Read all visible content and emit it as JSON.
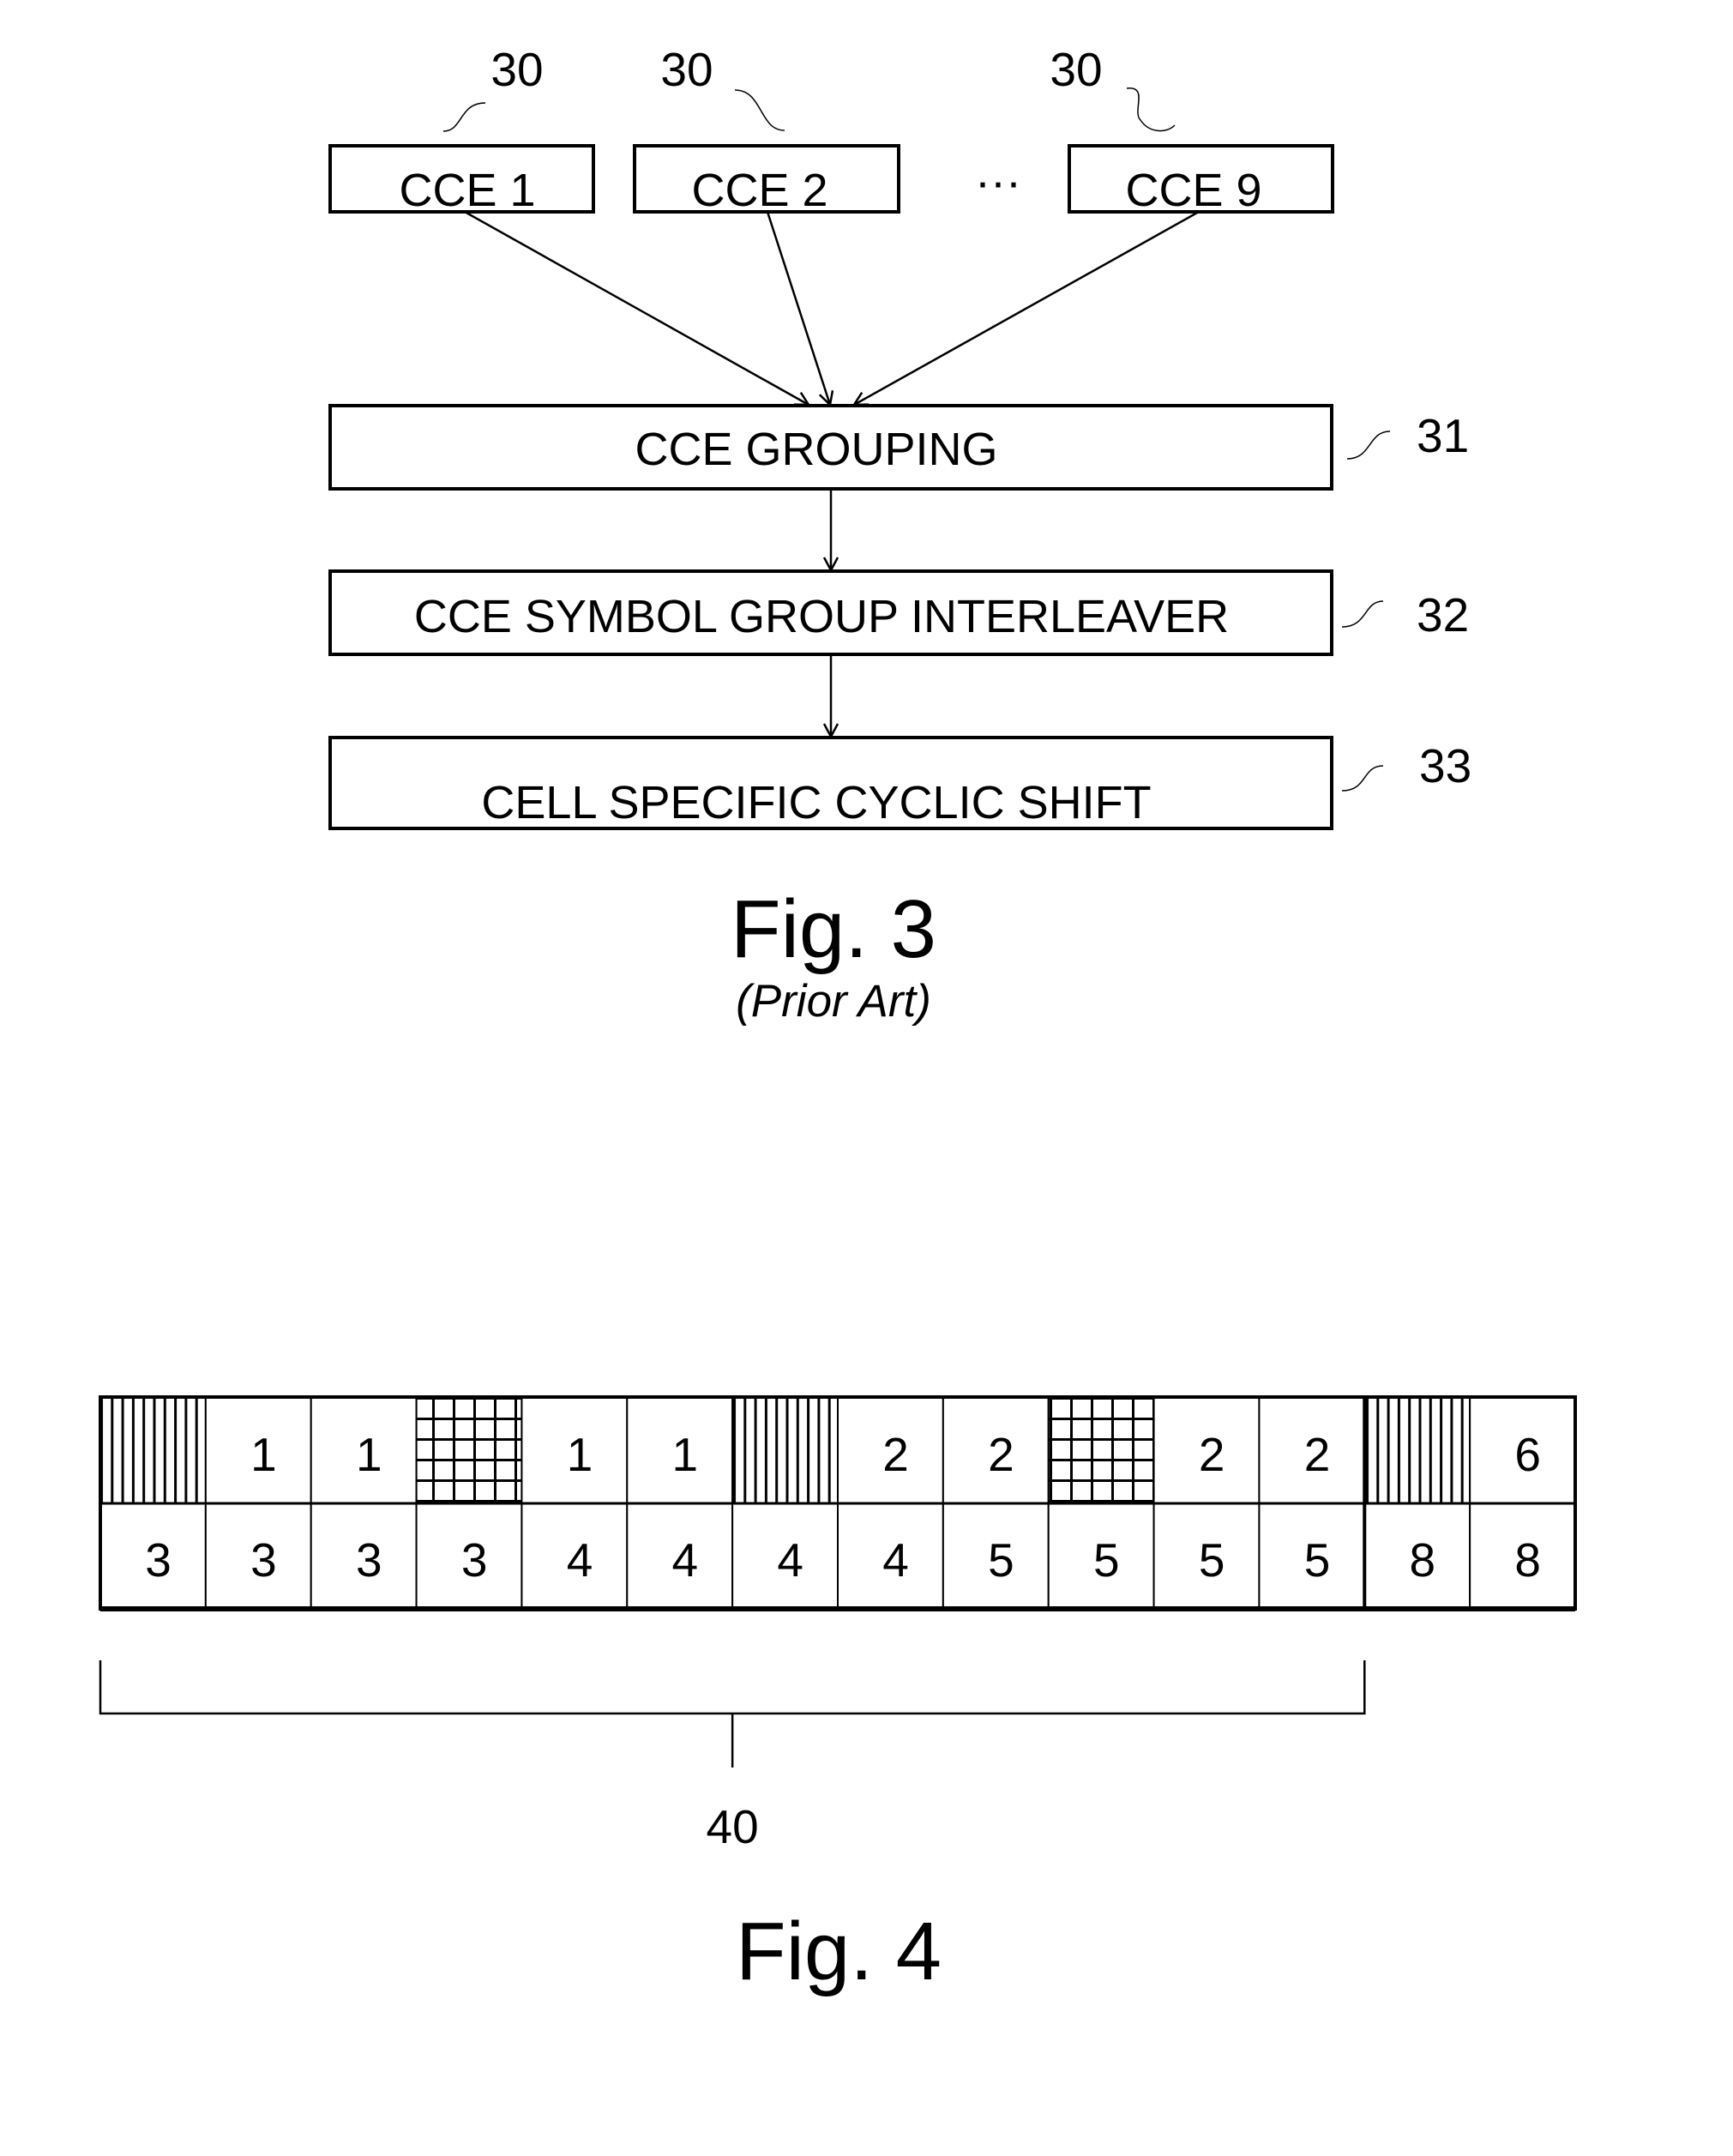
{
  "fig3": {
    "cce_blocks": [
      {
        "label": "CCE 1",
        "ref": "30"
      },
      {
        "label": "CCE 2",
        "ref": "30"
      },
      {
        "label": "CCE 9",
        "ref": "30"
      }
    ],
    "ellipsis": "···",
    "stages": [
      {
        "label": "CCE GROUPING",
        "ref": "31"
      },
      {
        "label": "CCE SYMBOL GROUP INTERLEAVER",
        "ref": "32"
      },
      {
        "label": "CELL SPECIFIC CYCLIC SHIFT",
        "ref": "33"
      }
    ],
    "caption": "Fig. 3",
    "subcaption": "(Prior Art)"
  },
  "fig4": {
    "top_row": [
      {
        "value": "",
        "pattern": "vertical-stripes"
      },
      {
        "value": "1",
        "pattern": "none"
      },
      {
        "value": "1",
        "pattern": "none"
      },
      {
        "value": "",
        "pattern": "crosshatch"
      },
      {
        "value": "1",
        "pattern": "none"
      },
      {
        "value": "1",
        "pattern": "none"
      },
      {
        "value": "",
        "pattern": "vertical-stripes"
      },
      {
        "value": "2",
        "pattern": "none"
      },
      {
        "value": "2",
        "pattern": "none"
      },
      {
        "value": "",
        "pattern": "crosshatch"
      },
      {
        "value": "2",
        "pattern": "none"
      },
      {
        "value": "2",
        "pattern": "none"
      },
      {
        "value": "",
        "pattern": "vertical-stripes"
      },
      {
        "value": "6",
        "pattern": "none"
      }
    ],
    "bottom_row": [
      {
        "value": "3"
      },
      {
        "value": "3"
      },
      {
        "value": "3"
      },
      {
        "value": "3"
      },
      {
        "value": "4"
      },
      {
        "value": "4"
      },
      {
        "value": "4"
      },
      {
        "value": "4"
      },
      {
        "value": "5"
      },
      {
        "value": "5"
      },
      {
        "value": "5"
      },
      {
        "value": "5"
      },
      {
        "value": "8"
      },
      {
        "value": "8"
      }
    ],
    "bracket_span_cells": 12,
    "bracket_ref": "40",
    "caption": "Fig. 4"
  }
}
